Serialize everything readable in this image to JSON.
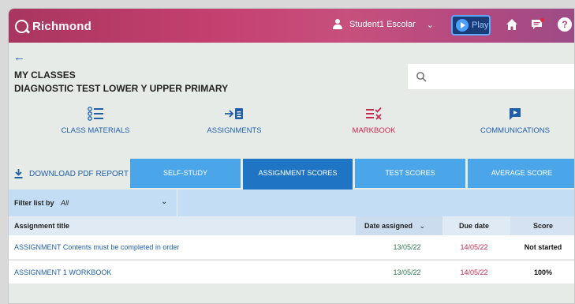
{
  "brand": {
    "name": "Richmond"
  },
  "header": {
    "user_name": "Student1 Escolar",
    "play_label": "Play",
    "help_glyph": "?"
  },
  "page": {
    "back_glyph": "←",
    "section_title": "MY CLASSES",
    "class_name": "DIAGNOSTIC TEST LOWER Y UPPER PRIMARY"
  },
  "search": {
    "placeholder": "",
    "value": ""
  },
  "nav": {
    "items": [
      {
        "label": "CLASS MATERIALS",
        "icon": "list-icon"
      },
      {
        "label": "ASSIGNMENTS",
        "icon": "assignment-icon"
      },
      {
        "label": "MARKBOOK",
        "icon": "markbook-icon",
        "active": true
      },
      {
        "label": "COMMUNICATIONS",
        "icon": "chat-icon"
      }
    ]
  },
  "actions": {
    "download_label": "DOWNLOAD PDF REPORT"
  },
  "tabs": [
    {
      "label": "SELF-STUDY"
    },
    {
      "label": "ASSIGNMENT SCORES",
      "active": true
    },
    {
      "label": "TEST SCORES"
    },
    {
      "label": "AVERAGE SCORE"
    }
  ],
  "filter": {
    "label": "Filter list by",
    "value": "All"
  },
  "table": {
    "columns": {
      "title": "Assignment title",
      "date_assigned": "Date assigned",
      "due_date": "Due date",
      "score": "Score"
    },
    "rows": [
      {
        "title": "ASSIGNMENT Contents must be completed in order",
        "date_assigned": "13/05/22",
        "due_date": "14/05/22",
        "score": "Not started"
      },
      {
        "title": "ASSIGNMENT 1 WORKBOOK",
        "date_assigned": "13/05/22",
        "due_date": "14/05/22",
        "score": "100%"
      }
    ]
  },
  "colors": {
    "header_gradient_start": "#a8365f",
    "header_gradient_end": "#9c4b86",
    "link_blue": "#1f5fa8",
    "active_red": "#c8294f",
    "tab_blue": "#4aa6e8",
    "tab_active": "#1f74c4",
    "date_green": "#2d7a4b"
  }
}
